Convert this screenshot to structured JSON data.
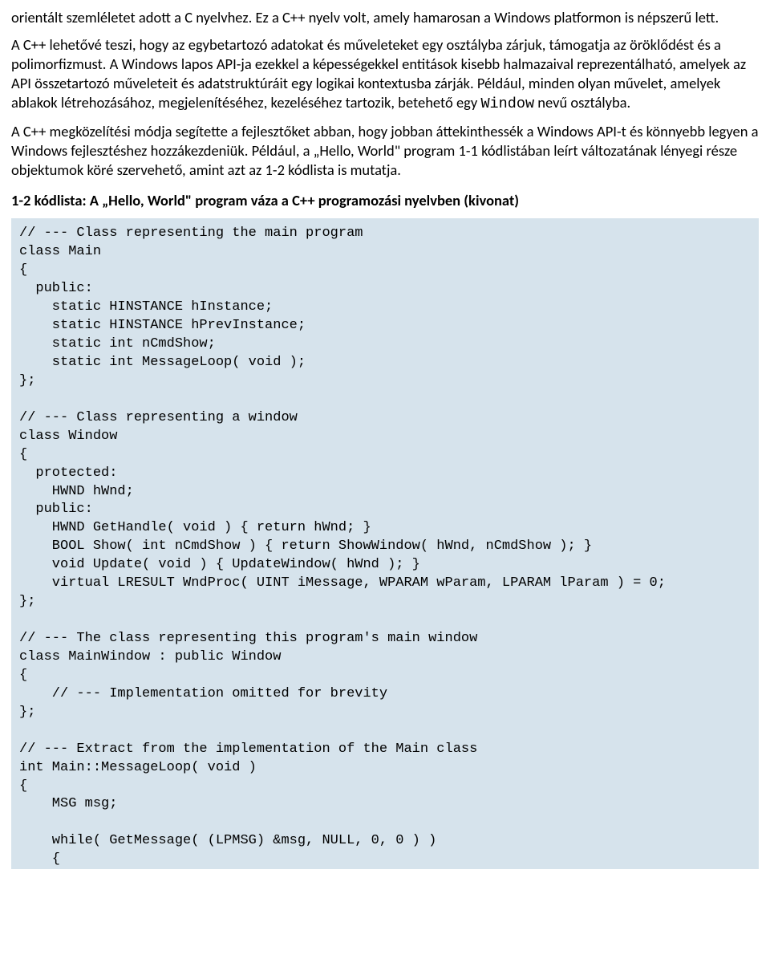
{
  "para1_a": "orientált szemléletet adott a C nyelvhez. Ez a C++ nyelv volt, amely hamarosan a Windows platformon is népszerű lett.",
  "para2_a": "A C++ lehetővé teszi, hogy az egybetartozó adatokat és műveleteket egy osztályba zárjuk, támogatja az öröklődést és a polimorfizmust. A Windows lapos API-ja ezekkel a képességekkel entitások kisebb halmazaival reprezentálható, amelyek az API összetartozó műveleteit és adatstruktúráit egy logikai kontextusba zárják. Például, minden olyan művelet, amelyek ablakok létrehozásához, megjelenítéséhez, kezeléséhez tartozik, betehető egy ",
  "para2_code": "Window",
  "para2_b": " nevű osztályba.",
  "para3": "A C++ megközelítési módja segítette a fejlesztőket abban, hogy jobban áttekinthessék a Windows API-t és könnyebb legyen a Windows fejlesztéshez hozzákezdeniük. Például, a „Hello, World\" program 1-1 kódlistában leírt változatának lényegi része objektumok köré szervehető, amint azt az 1-2 kódlista is mutatja.",
  "heading": "1-2 kódlista: A „Hello, World\" program váza a C++ programozási nyelvben (kivonat)",
  "code": "// --- Class representing the main program\nclass Main\n{\n  public:\n    static HINSTANCE hInstance;\n    static HINSTANCE hPrevInstance;\n    static int nCmdShow;\n    static int MessageLoop( void );\n};\n\n// --- Class representing a window\nclass Window\n{\n  protected:\n    HWND hWnd;\n  public:\n    HWND GetHandle( void ) { return hWnd; }\n    BOOL Show( int nCmdShow ) { return ShowWindow( hWnd, nCmdShow ); }\n    void Update( void ) { UpdateWindow( hWnd ); }\n    virtual LRESULT WndProc( UINT iMessage, WPARAM wParam, LPARAM lParam ) = 0;\n};\n\n// --- The class representing this program's main window\nclass MainWindow : public Window\n{\n    // --- Implementation omitted for brevity\n};\n\n// --- Extract from the implementation of the Main class\nint Main::MessageLoop( void )\n{\n    MSG msg;\n\n    while( GetMessage( (LPMSG) &msg, NULL, 0, 0 ) )\n    {"
}
